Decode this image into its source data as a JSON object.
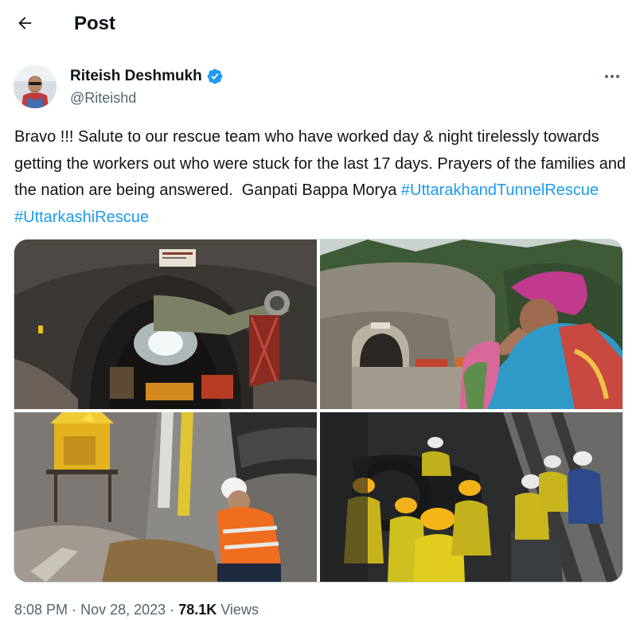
{
  "header": {
    "back_icon": "arrow-left-icon",
    "title": "Post"
  },
  "author": {
    "name": "Riteish Deshmukh",
    "handle": "@Riteishd",
    "verified": true,
    "verified_color": "#1d9bf0"
  },
  "tweet": {
    "text": "Bravo !!! Salute to our rescue team who have worked day & night tirelessly towards getting the workers out who were stuck for the last 17 days. Prayers of the families and the nation are being answered.  Ganpati Bappa Morya ",
    "hashtags": [
      "#UttarakhandTunnelRescue",
      "#UttarkashiRescue"
    ],
    "hashtag_color": "#1d9bf0"
  },
  "media": {
    "photos": [
      {
        "subject": "tunnel-entrance-with-machinery"
      },
      {
        "subject": "tunnel-portal-woman-praying"
      },
      {
        "subject": "shrine-and-rescue-worker"
      },
      {
        "subject": "workers-in-helmets-with-pipe"
      }
    ]
  },
  "meta": {
    "time": "8:08 PM",
    "date": "Nov 28, 2023",
    "separator": "·",
    "views_count": "78.1K",
    "views_label": "Views"
  }
}
